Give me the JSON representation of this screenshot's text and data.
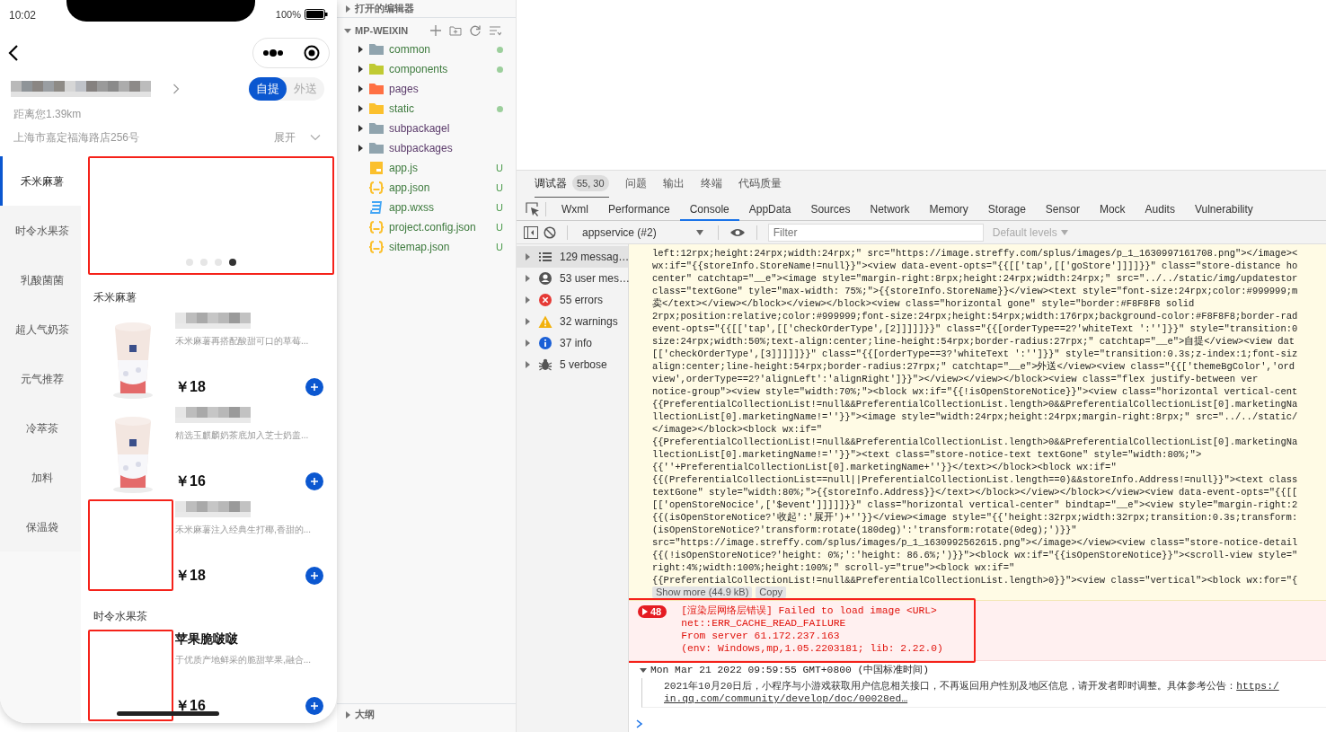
{
  "phone": {
    "status_bar": {
      "time": "10:02",
      "battery": "100%"
    },
    "store": {
      "name_redacted": true,
      "distance": "距离您1.39km",
      "address": "上海市嘉定福海路店256号",
      "expand_label": "展开",
      "order_types": [
        {
          "label": "自提",
          "selected": true
        },
        {
          "label": "外送",
          "selected": false
        }
      ]
    },
    "categories": [
      {
        "label": "禾米麻薯",
        "selected": true
      },
      {
        "label": "时令水果茶",
        "selected": false
      },
      {
        "label": "乳酸菌菌",
        "selected": false
      },
      {
        "label": "超人气奶茶",
        "selected": false
      },
      {
        "label": "元气推荐",
        "selected": false
      },
      {
        "label": "冷萃茶",
        "selected": false
      },
      {
        "label": "加料",
        "selected": false
      },
      {
        "label": "保温袋",
        "selected": false
      }
    ],
    "banner": {
      "annotated": true,
      "dots": [
        {
          "selected": false
        },
        {
          "selected": false
        },
        {
          "selected": false
        },
        {
          "selected": true
        }
      ]
    },
    "sections": [
      {
        "title": "禾米麻薯",
        "products": [
          {
            "name_redacted": true,
            "description": "禾米麻薯再搭配酸甜可口的草莓...",
            "price": "￥18",
            "kind": "picture",
            "annotated": false
          },
          {
            "name_redacted": true,
            "description": "精选玉麒麟奶茶底加入芝士奶盖...",
            "price": "￥16",
            "kind": "picture",
            "annotated": false
          },
          {
            "name_redacted": true,
            "description": "禾米麻薯注入经典生打椰,香甜的...",
            "price": "￥18",
            "kind": "blank",
            "annotated": true
          }
        ]
      },
      {
        "title": "时令水果茶",
        "products": [
          {
            "name_redacted": false,
            "name": "苹果脆啵啵",
            "description": "于优质产地鲜采的脆甜苹果,融合...",
            "price": "￥16",
            "kind": "blank",
            "annotated": true
          }
        ]
      }
    ]
  },
  "explorer": {
    "open_editors": {
      "title": "打开的编辑器",
      "expanded": false
    },
    "project": {
      "title": "MP-WEIXIN",
      "expanded": true,
      "items": [
        {
          "label": "common",
          "kind": "folder",
          "color": "#90a4ae",
          "modified": true
        },
        {
          "label": "components",
          "kind": "folder",
          "color": "#c0ca33",
          "modified": true
        },
        {
          "label": "pages",
          "kind": "folder",
          "color": "#ff7043",
          "modified": false
        },
        {
          "label": "static",
          "kind": "folder",
          "color": "#fbc02d",
          "modified": true
        },
        {
          "label": "subpackagel",
          "kind": "folder",
          "color": "#90a4ae",
          "modified": false
        },
        {
          "label": "subpackages",
          "kind": "folder",
          "color": "#90a4ae",
          "modified": false
        },
        {
          "label": "app.js",
          "kind": "js",
          "color": "#fbc02d",
          "status": "U"
        },
        {
          "label": "app.json",
          "kind": "json",
          "color": "#fbc02d",
          "status": "U"
        },
        {
          "label": "app.wxss",
          "kind": "css",
          "color": "#42a5f5",
          "status": "U"
        },
        {
          "label": "project.config.json",
          "kind": "json",
          "color": "#fbc02d",
          "status": "U"
        },
        {
          "label": "sitemap.json",
          "kind": "json",
          "color": "#fbc02d",
          "status": "U"
        }
      ]
    },
    "outline": {
      "title": "大纲",
      "expanded": false
    }
  },
  "devtools": {
    "panel_tabs": [
      {
        "label": "调试器",
        "selected": true,
        "badge": "55, 30"
      },
      {
        "label": "问题",
        "selected": false
      },
      {
        "label": "输出",
        "selected": false
      },
      {
        "label": "终端",
        "selected": false
      },
      {
        "label": "代码质量",
        "selected": false
      }
    ],
    "tool_tabs": [
      {
        "label": "Wxml",
        "selected": false
      },
      {
        "label": "Performance",
        "selected": false
      },
      {
        "label": "Console",
        "selected": true
      },
      {
        "label": "AppData",
        "selected": false
      },
      {
        "label": "Sources",
        "selected": false
      },
      {
        "label": "Network",
        "selected": false
      },
      {
        "label": "Memory",
        "selected": false
      },
      {
        "label": "Storage",
        "selected": false
      },
      {
        "label": "Sensor",
        "selected": false
      },
      {
        "label": "Mock",
        "selected": false
      },
      {
        "label": "Audits",
        "selected": false
      },
      {
        "label": "Vulnerability",
        "selected": false
      }
    ],
    "toolbar": {
      "context": "appservice (#2)",
      "filter_placeholder": "Filter",
      "levels": "Default levels",
      "levels_disabled": true
    },
    "sidebar": [
      {
        "label": "129 messag…",
        "kind": "messages",
        "selected": true
      },
      {
        "label": "53 user mes…",
        "kind": "user",
        "selected": false
      },
      {
        "label": "55 errors",
        "kind": "error",
        "selected": false
      },
      {
        "label": "32 warnings",
        "kind": "warning",
        "selected": false
      },
      {
        "label": "37 info",
        "kind": "info",
        "selected": false
      },
      {
        "label": "5 verbose",
        "kind": "verbose",
        "selected": false
      }
    ],
    "code_entry": {
      "lines": [
        "left:12rpx;height:24rpx;width:24rpx;\" src=\"https://image.streffy.com/splus/images/p_1_1630997161708.png\"></image><",
        "wx:if=\"{{storeInfo.StoreName!=null}}\"><view data-event-opts=\"{{[['tap',[['goStore']]]]}}\" class=\"store-distance ho",
        "center\" catchtap=\"__e\"><image style=\"margin-right:8rpx;height:24rpx;width:24rpx;\" src=\"../../static/img/updatestor",
        "class=\"textGone\" tyle=\"max-width: 75%;\">{{storeInfo.StoreName}}</view><text style=\"font-size:24rpx;color:#999999;m",
        "卖</text></view></block></view></block><view class=\"horizontal gone\" style=\"border:#F8F8F8 solid",
        "2rpx;position:relative;color:#999999;font-size:24rpx;height:54rpx;width:176rpx;background-color:#F8F8F8;border-rad",
        "event-opts=\"{{[['tap',[['checkOrderType',[2]]]]]}}\" class=\"{{[orderType==2?'whiteText ':'']}}\" style=\"transition:0",
        "size:24rpx;width:50%;text-align:center;line-height:54rpx;border-radius:27rpx;\" catchtap=\"__e\">自提</view><view dat",
        "[['checkOrderType',[3]]]]]}}\" class=\"{{[orderType==3?'whiteText ':'']}}\" style=\"transition:0.3s;z-index:1;font-siz",
        "align:center;line-height:54rpx;border-radius:27rpx;\" catchtap=\"__e\">外送</view><view class=\"{{['themeBgColor','ord",
        "view',orderType==2?'alignLeft':'alignRight']}}\"></view></view></block><view class=\"flex justify-between ver",
        "notice-group\"><view style=\"width:70%;\"><block wx:if=\"{{!isOpenStoreNotice}}\"><view class=\"horizontal vertical-cent",
        "{{PreferentialCollectionList!=null&&PreferentialCollectionList.length>0&&PreferentialCollectionList[0].marketingNa",
        "llectionList[0].marketingName!=''}}\"><image style=\"width:24rpx;height:24rpx;margin-right:8rpx;\" src=\"../../static/",
        "</image></block><block wx:if=\"",
        "{{PreferentialCollectionList!=null&&PreferentialCollectionList.length>0&&PreferentialCollectionList[0].marketingNa",
        "llectionList[0].marketingName!=''}}\"><text class=\"store-notice-text textGone\" style=\"width:80%;\">",
        "{{''+PreferentialCollectionList[0].marketingName+''}}</text></block><block wx:if=\"",
        "{{(PreferentialCollectionList==null||PreferentialCollectionList.length==0)&&storeInfo.Address!=null}}\"><text class",
        "textGone\" style=\"width:80%;\">{{storeInfo.Address}}</text></block></view></block></view><view data-event-opts=\"{{[[",
        "[['openStoreNocice',['$event']]]]]}}\" class=\"horizontal vertical-center\" bindtap=\"__e\"><view style=\"margin-right:2",
        "{{(isOpenStoreNotice?'收起':'展开')+''}}</view><image style=\"{{'height:32rpx;width:32rpx;transition:0.3s;transform:",
        "(isOpenStoreNotice?'transform:rotate(180deg)':'transform:rotate(0deg);')}}\"",
        "src=\"https://image.streffy.com/splus/images/p_1_1630992562615.png\"></image></view><view class=\"store-notice-detail",
        "{{(!isOpenStoreNotice?'height: 0%;':'height: 86.6%;')}}\"><block wx:if=\"{{isOpenStoreNotice}}\"><scroll-view style=\"",
        "right:4%;width:100%;height:100%;\" scroll-y=\"true\"><block wx:if=\"",
        "{{PreferentialCollectionList!=null&&PreferentialCollectionList.length>0}}\"><view class=\"vertical\"><block wx:for=\"{"
      ],
      "buttons": [
        "Show more (44.9 kB)",
        "Copy"
      ]
    },
    "error_entry": {
      "count": "48",
      "annotated": true,
      "lines": [
        "[渲染层网络层错误] Failed to load image <URL>",
        "net::ERR_CACHE_READ_FAILURE",
        "From server 61.172.237.163",
        "(env: Windows,mp,1.05.2203181; lib: 2.22.0)"
      ]
    },
    "group_entry": {
      "expanded": true,
      "header": "Mon Mar 21 2022 09:59:55 GMT+0800 (中国标准时间)",
      "message": "2021年10月20日后，小程序与小游戏获取用户信息相关接口，不再返回用户性别及地区信息，请开发者即时调整。具体参考公告：",
      "link_parts": [
        "https:/",
        "in.qq.com/community/develop/doc/00028ed…"
      ]
    }
  }
}
